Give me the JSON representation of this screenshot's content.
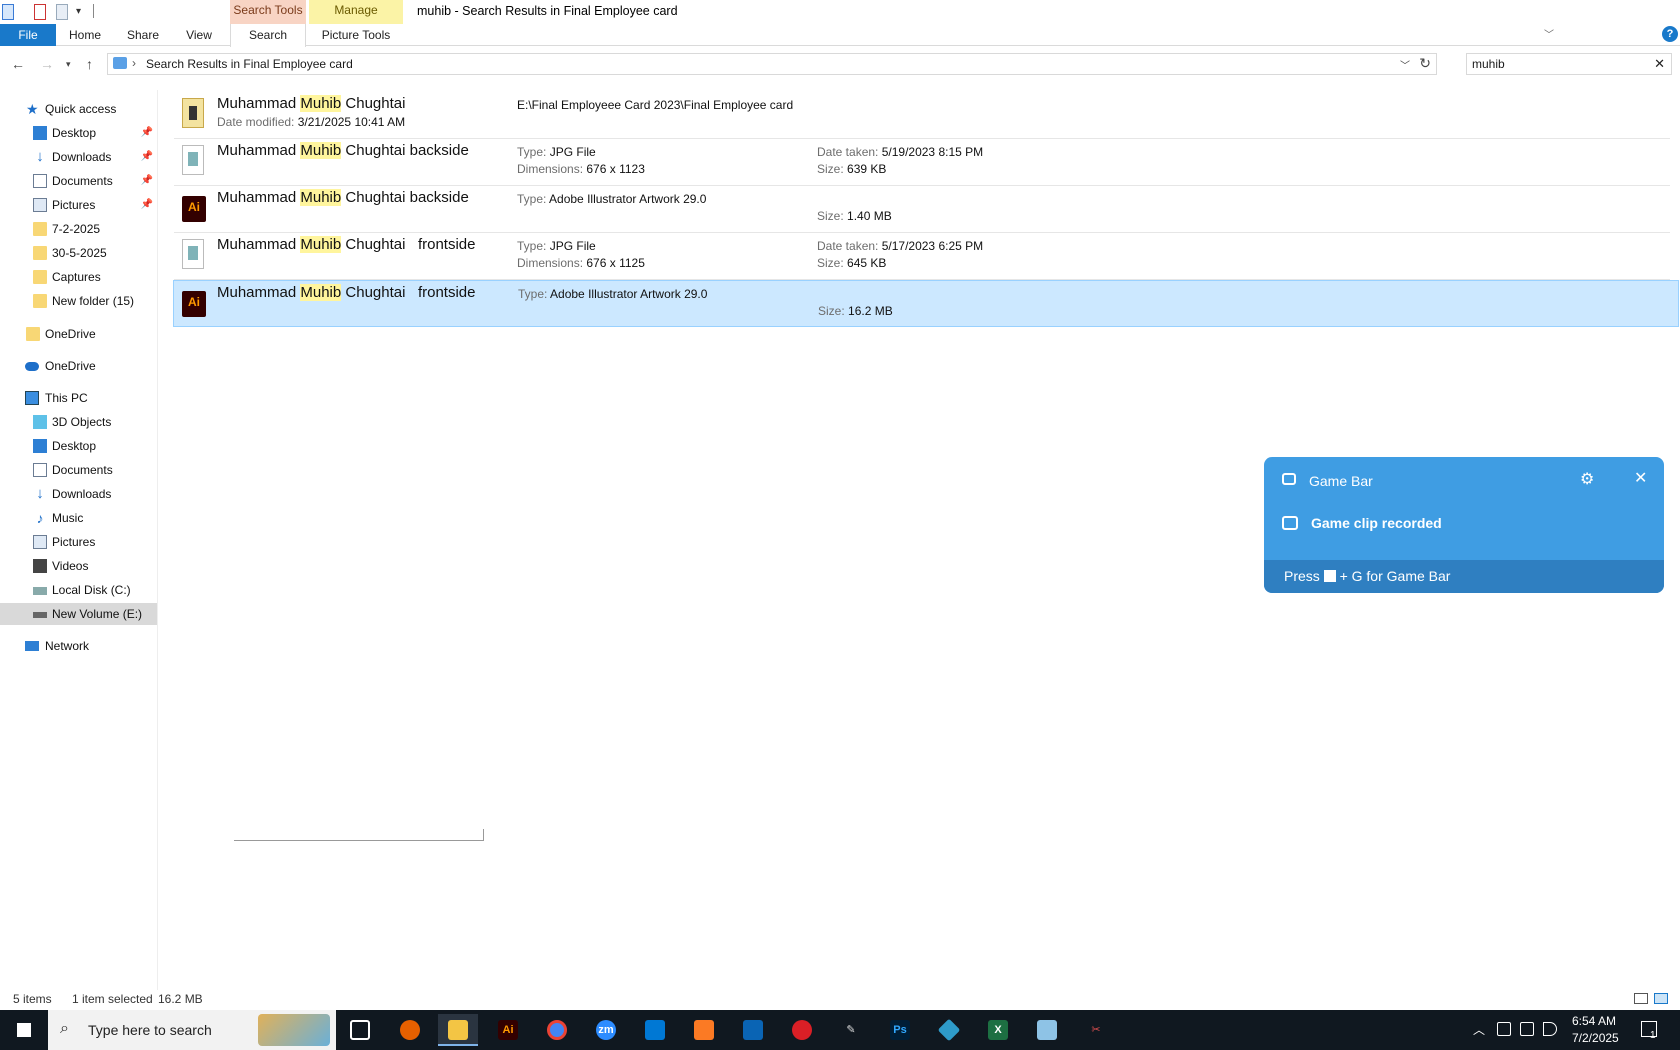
{
  "window": {
    "title": "muhib - Search Results in Final Employee card",
    "context_tabs": {
      "search_tools": "Search Tools",
      "manage": "Manage"
    }
  },
  "ribbon": {
    "tabs": [
      "File",
      "Home",
      "Share",
      "View",
      "Search",
      "Picture Tools"
    ]
  },
  "address": {
    "path": "Search Results in Final Employee card",
    "search_value": "muhib",
    "separator": "›"
  },
  "nav": {
    "quick_access": "Quick access",
    "items": [
      {
        "label": "Desktop",
        "pinned": true
      },
      {
        "label": "Downloads",
        "pinned": true
      },
      {
        "label": "Documents",
        "pinned": true
      },
      {
        "label": "Pictures",
        "pinned": true
      },
      {
        "label": "7-2-2025"
      },
      {
        "label": "30-5-2025"
      },
      {
        "label": "Captures"
      },
      {
        "label": "New folder (15)"
      }
    ],
    "onedrive_folder": "OneDrive",
    "onedrive": "OneDrive",
    "this_pc": "This PC",
    "pc_items": [
      "3D Objects",
      "Desktop",
      "Documents",
      "Downloads",
      "Music",
      "Pictures",
      "Videos",
      "Local Disk (C:)",
      "New Volume (E:)"
    ],
    "network": "Network"
  },
  "files": [
    {
      "name_pre": "Muhammad ",
      "name_hl": "Muhib",
      "name_post": " Chughtai",
      "icon": "shortcut-icon",
      "k1": "Date modified:",
      "v1": "3/21/2025 10:41 AM",
      "path": "E:\\Final  Employeee Card 2023\\Final Employee card"
    },
    {
      "name_pre": "Muhammad ",
      "name_hl": "Muhib",
      "name_post": " Chughtai backside",
      "icon": "jpg-icon",
      "type_k": "Type:",
      "type_v": "JPG File",
      "dim_k": "Dimensions:",
      "dim_v": "676 x 1123",
      "date_k": "Date taken:",
      "date_v": "5/19/2023 8:15 PM",
      "size_k": "Size:",
      "size_v": "639 KB"
    },
    {
      "name_pre": "Muhammad ",
      "name_hl": "Muhib",
      "name_post": " Chughtai backside",
      "icon": "ai-icon",
      "type_k": "Type:",
      "type_v": "Adobe Illustrator Artwork 29.0",
      "size_k": "Size:",
      "size_v": "1.40 MB"
    },
    {
      "name_pre": "Muhammad ",
      "name_hl": "Muhib",
      "name_post": " Chughtai   frontside",
      "icon": "jpg-icon",
      "type_k": "Type:",
      "type_v": "JPG File",
      "dim_k": "Dimensions:",
      "dim_v": "676 x 1125",
      "date_k": "Date taken:",
      "date_v": "5/17/2023 6:25 PM",
      "size_k": "Size:",
      "size_v": "645 KB"
    },
    {
      "name_pre": "Muhammad ",
      "name_hl": "Muhib",
      "name_post": " Chughtai   frontside",
      "icon": "ai-icon",
      "type_k": "Type:",
      "type_v": "Adobe Illustrator Artwork 29.0",
      "size_k": "Size:",
      "size_v": "16.2 MB",
      "selected": true
    }
  ],
  "ai_glyph": "Ai",
  "status": {
    "count": "5 items",
    "selected": "1 item selected",
    "size": "16.2 MB"
  },
  "toast": {
    "title": "Game Bar",
    "message": "Game clip recorded",
    "footer_pre": "Press ",
    "footer_post": " + G for Game Bar"
  },
  "taskbar": {
    "search_placeholder": "Type here to search",
    "apps": [
      "task-view",
      "firefox",
      "file-explorer",
      "illustrator",
      "chrome",
      "zoom",
      "vscode",
      "xampp",
      "outlook",
      "creative-cloud",
      "pen-tool",
      "photoshop",
      "app-blue",
      "excel",
      "notepad",
      "snipping"
    ],
    "app_glyphs": {
      "illustrator": "Ai",
      "zoom": "zm",
      "photoshop": "Ps",
      "excel": "X"
    },
    "time": "6:54 AM",
    "date": "7/2/2025",
    "notification_count": "1"
  },
  "colors": {
    "accent": "#1979ca",
    "selection": "#cce8ff",
    "highlight": "#fff59d",
    "toast": "#3f9de3",
    "taskbar": "#101820"
  }
}
